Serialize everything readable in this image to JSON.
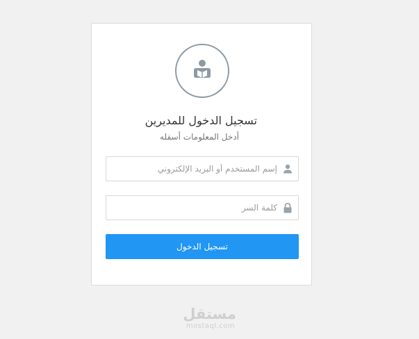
{
  "login": {
    "avatar_icon": "reader-icon",
    "title": "تسجيل الدخول للمديرين",
    "subtitle": "أدخل المعلومات أسفله",
    "username": {
      "placeholder": "إسم المستخدم أو البريد الإلكتروني",
      "value": "",
      "icon": "user-icon"
    },
    "password": {
      "placeholder": "كلمة السر",
      "value": "",
      "icon": "lock-icon"
    },
    "submit_label": "تسجيل الدخول"
  },
  "watermark": {
    "text_ar": "مستقل",
    "text_en": "mostaql.com"
  },
  "colors": {
    "accent": "#2196f3",
    "icon": "#8e9aa3",
    "background": "#f1f1f1"
  }
}
